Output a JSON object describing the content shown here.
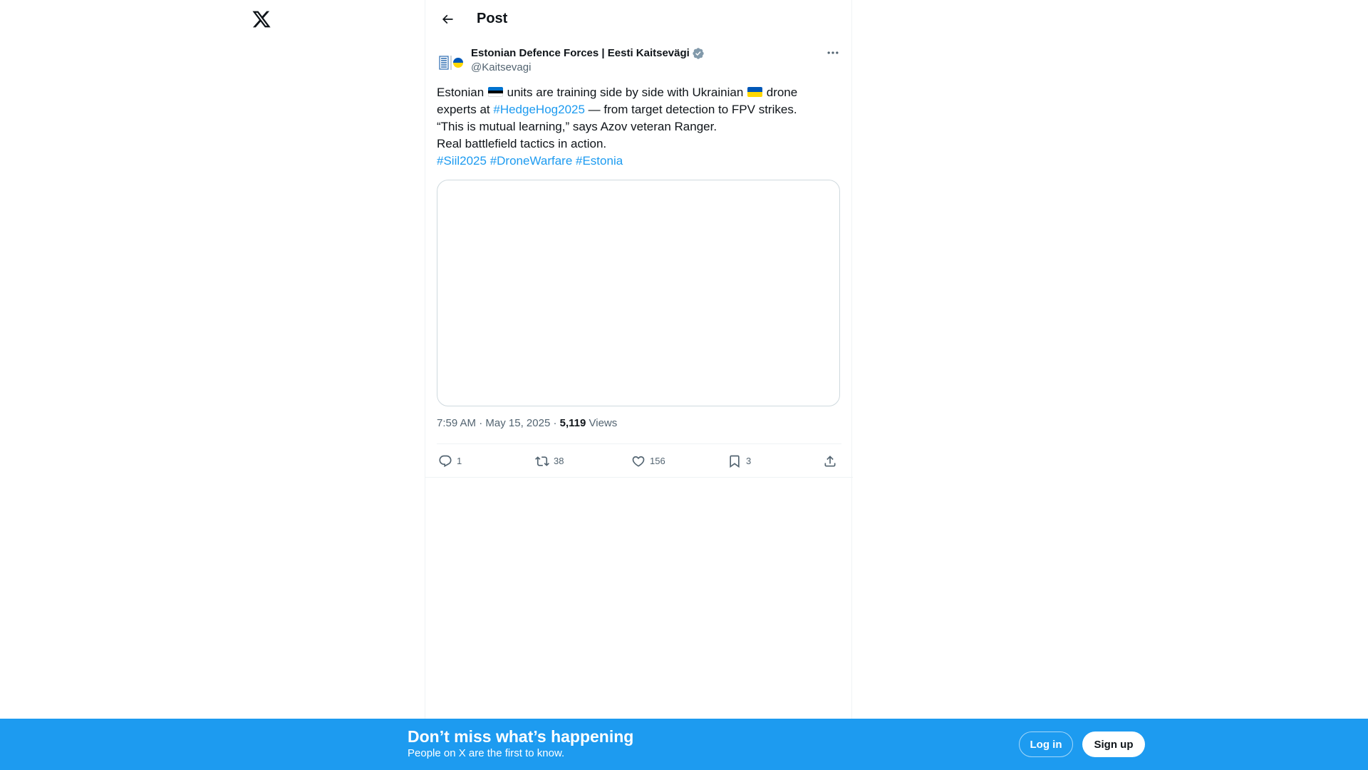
{
  "header": {
    "title": "Post"
  },
  "tweet": {
    "author_name": "Estonian Defence Forces | Eesti Kaitsevägi",
    "author_handle": "@Kaitsevagi",
    "text": {
      "l1_a": "Estonian ",
      "l1_b": " units are training side by side with Ukrainian ",
      "l1_c": " drone",
      "l2_a": "experts at ",
      "l2_tag": "#HedgeHog2025",
      "l2_b": " — from target detection to FPV strikes.",
      "l3": "“This is mutual learning,” says Azov veteran Ranger.",
      "l4": "Real battlefield tactics in action.",
      "tags": [
        "#Siil2025",
        "#DroneWarfare",
        "#Estonia"
      ]
    },
    "time": "7:59 AM",
    "separator": " · ",
    "date": "May 15, 2025",
    "views_count": "5,119",
    "views_label": " Views"
  },
  "actions": {
    "replies": "1",
    "reposts": "38",
    "likes": "156",
    "bookmarks": "3"
  },
  "icons": {
    "logo": "x-logo-icon",
    "back": "arrow-left-icon",
    "more": "more-horizontal-icon",
    "verified": "verified-badge-icon",
    "reply": "reply-icon",
    "repost": "repost-icon",
    "like": "heart-icon",
    "bookmark": "bookmark-icon",
    "share": "share-icon"
  },
  "banner": {
    "title": "Don’t miss what’s happening",
    "subtitle": "People on X are the first to know.",
    "login_label": "Log in",
    "signup_label": "Sign up"
  },
  "colors": {
    "accent": "#1d9bf0",
    "text_primary": "#0f1419",
    "text_secondary": "#536471",
    "verified_badge": "#829aab"
  }
}
